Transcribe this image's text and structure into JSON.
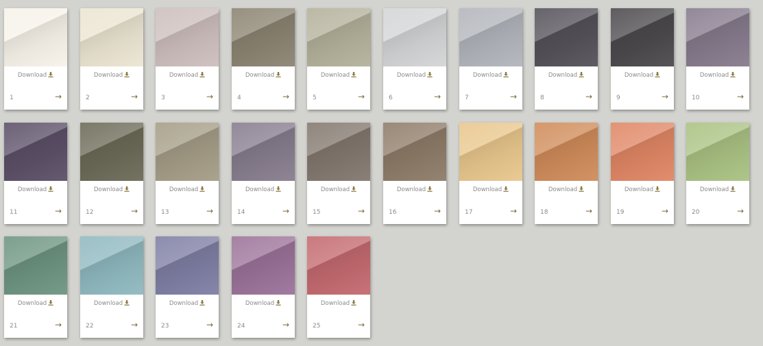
{
  "download_label": "Download",
  "icons": {
    "download": "download-icon",
    "arrow": "arrow-right-icon"
  },
  "colors": {
    "background": "#d3d3cf",
    "card": "#ffffff",
    "text": "#8a8a8a",
    "accent": "#8b7a45"
  },
  "swatches": [
    {
      "number": "1",
      "color": "#f7f3ea"
    },
    {
      "number": "2",
      "color": "#ece5d2"
    },
    {
      "number": "3",
      "color": "#cdbfbd"
    },
    {
      "number": "4",
      "color": "#8c8472"
    },
    {
      "number": "5",
      "color": "#b4b19b"
    },
    {
      "number": "6",
      "color": "#d3d5d6"
    },
    {
      "number": "7",
      "color": "#b2b5bc"
    },
    {
      "number": "8",
      "color": "#55525a"
    },
    {
      "number": "9",
      "color": "#4c4a4d"
    },
    {
      "number": "10",
      "color": "#877b8d"
    },
    {
      "number": "11",
      "color": "#5c5068"
    },
    {
      "number": "12",
      "color": "#6c6b58"
    },
    {
      "number": "13",
      "color": "#a59d87"
    },
    {
      "number": "14",
      "color": "#877d8e"
    },
    {
      "number": "15",
      "color": "#83786f"
    },
    {
      "number": "16",
      "color": "#8f7c69"
    },
    {
      "number": "17",
      "color": "#e9c78d"
    },
    {
      "number": "18",
      "color": "#d08c5a"
    },
    {
      "number": "19",
      "color": "#e08765"
    },
    {
      "number": "20",
      "color": "#aac283"
    },
    {
      "number": "21",
      "color": "#6e9581"
    },
    {
      "number": "22",
      "color": "#8fb9c0"
    },
    {
      "number": "23",
      "color": "#7f7fa5"
    },
    {
      "number": "24",
      "color": "#9c739a"
    },
    {
      "number": "25",
      "color": "#c46a70"
    }
  ]
}
